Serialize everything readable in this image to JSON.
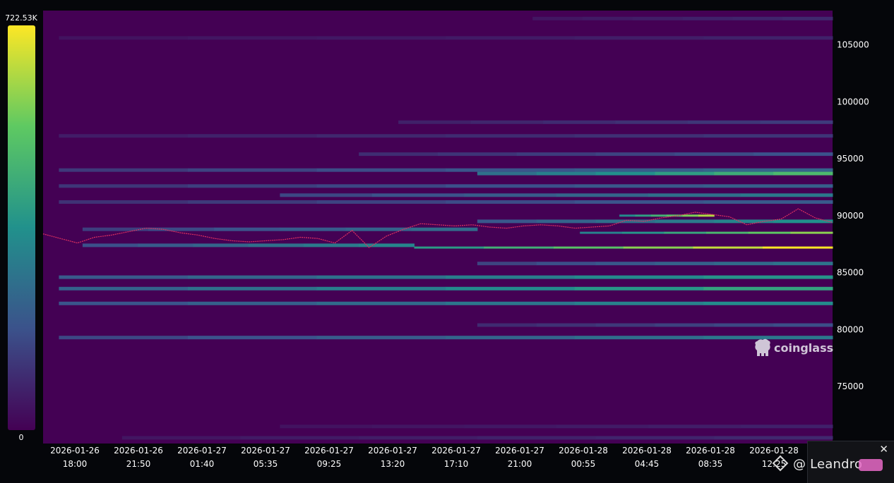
{
  "chart_data": {
    "type": "heatmap",
    "title": "",
    "xlabel": "",
    "ylabel": "",
    "colorbar": {
      "max_label": "722.53K",
      "min_label": "0",
      "max": 722530,
      "min": 0
    },
    "ylim": [
      70000,
      108000
    ],
    "y_ticks": [
      {
        "value": 105000,
        "label": "105000"
      },
      {
        "value": 100000,
        "label": "100000"
      },
      {
        "value": 95000,
        "label": "95000"
      },
      {
        "value": 90000,
        "label": "90000"
      },
      {
        "value": 85000,
        "label": "85000"
      },
      {
        "value": 80000,
        "label": "80000"
      },
      {
        "value": 75000,
        "label": "75000"
      }
    ],
    "x_ticks": [
      {
        "date": "2026-01-26",
        "time": "18:00"
      },
      {
        "date": "2026-01-26",
        "time": "21:50"
      },
      {
        "date": "2026-01-27",
        "time": "01:40"
      },
      {
        "date": "2026-01-27",
        "time": "05:35"
      },
      {
        "date": "2026-01-27",
        "time": "09:25"
      },
      {
        "date": "2026-01-27",
        "time": "13:20"
      },
      {
        "date": "2026-01-27",
        "time": "17:10"
      },
      {
        "date": "2026-01-27",
        "time": "21:00"
      },
      {
        "date": "2026-01-28",
        "time": "00:55"
      },
      {
        "date": "2026-01-28",
        "time": "04:45"
      },
      {
        "date": "2026-01-28",
        "time": "08:35"
      },
      {
        "date": "2026-01-28",
        "time": "12:25"
      }
    ],
    "liquidation_levels": [
      {
        "price": 107300,
        "start": 0.62,
        "intensity": 0.12
      },
      {
        "price": 105600,
        "start": 0.02,
        "intensity": 0.1
      },
      {
        "price": 98200,
        "start": 0.45,
        "intensity": 0.18
      },
      {
        "price": 97000,
        "start": 0.02,
        "intensity": 0.16
      },
      {
        "price": 95400,
        "start": 0.4,
        "intensity": 0.25
      },
      {
        "price": 94000,
        "start": 0.02,
        "intensity": 0.32
      },
      {
        "price": 93700,
        "start": 0.55,
        "intensity": 0.68
      },
      {
        "price": 92600,
        "start": 0.02,
        "intensity": 0.3
      },
      {
        "price": 91800,
        "start": 0.3,
        "intensity": 0.4
      },
      {
        "price": 91200,
        "start": 0.02,
        "intensity": 0.28
      },
      {
        "price": 90000,
        "start": 0.73,
        "intensity": 0.88,
        "end": 0.85
      },
      {
        "price": 89500,
        "start": 0.55,
        "intensity": 0.5
      },
      {
        "price": 88500,
        "start": 0.68,
        "intensity": 0.82
      },
      {
        "price": 88800,
        "start": 0.05,
        "intensity": 0.35,
        "end": 0.55
      },
      {
        "price": 87200,
        "start": 0.47,
        "intensity": 1.0
      },
      {
        "price": 87400,
        "start": 0.05,
        "intensity": 0.45,
        "end": 0.47
      },
      {
        "price": 85800,
        "start": 0.55,
        "intensity": 0.38
      },
      {
        "price": 84600,
        "start": 0.02,
        "intensity": 0.52
      },
      {
        "price": 83600,
        "start": 0.02,
        "intensity": 0.58
      },
      {
        "price": 82300,
        "start": 0.02,
        "intensity": 0.48
      },
      {
        "price": 80400,
        "start": 0.55,
        "intensity": 0.24
      },
      {
        "price": 79300,
        "start": 0.02,
        "intensity": 0.4
      },
      {
        "price": 71500,
        "start": 0.3,
        "intensity": 0.1
      },
      {
        "price": 70500,
        "start": 0.1,
        "intensity": 0.12
      }
    ],
    "price_series": [
      88400,
      88000,
      87600,
      88100,
      88300,
      88600,
      88900,
      88800,
      88500,
      88300,
      88000,
      87800,
      87700,
      87800,
      87900,
      88100,
      88000,
      87600,
      88700,
      87200,
      88200,
      88800,
      89300,
      89200,
      89100,
      89200,
      89000,
      88900,
      89100,
      89200,
      89100,
      88900,
      89000,
      89100,
      89600,
      89500,
      89800,
      90000,
      90300,
      90100,
      89900,
      89200,
      89500,
      89700,
      90600,
      89800,
      89400
    ]
  },
  "watermark": {
    "text": "coinglass"
  },
  "toast": {
    "close": "✕",
    "handle": "@ Leandro"
  },
  "colors": {
    "background": "#440154",
    "low": "#3b528b",
    "mid": "#21918c",
    "high": "#5ec962",
    "peak": "#fde725",
    "price_line": "#e0315f"
  }
}
